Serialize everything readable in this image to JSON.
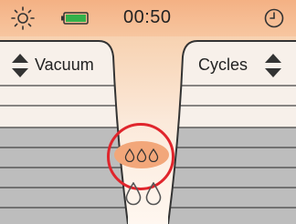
{
  "status_bar": {
    "time": "00:50",
    "icons": [
      "brightness-icon",
      "battery-icon",
      "timer-icon"
    ]
  },
  "left_panel": {
    "label": "Vacuum"
  },
  "right_panel": {
    "label": "Cycles"
  },
  "dosage": {
    "selected_drops": 3,
    "secondary_drops": 2
  },
  "colors": {
    "status_bar": "#f4b184",
    "highlight": "#f2a77a",
    "selection_ring": "#e0252c",
    "panel_light": "#f7f0ea",
    "panel_dark": "#bdbdbd"
  }
}
